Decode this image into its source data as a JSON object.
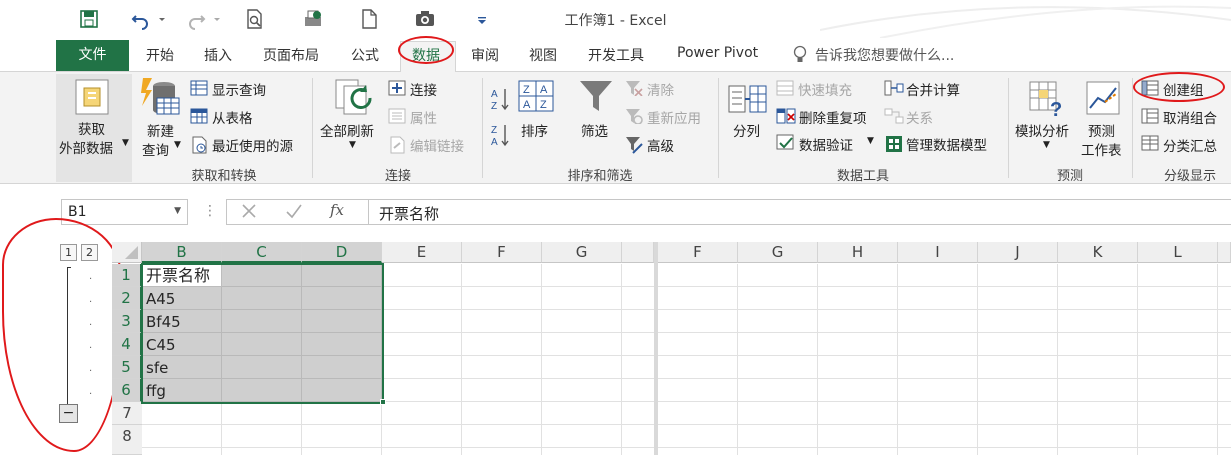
{
  "title": "工作簿1 - Excel",
  "tabs": [
    "开始",
    "插入",
    "页面布局",
    "公式",
    "数据",
    "审阅",
    "视图",
    "开发工具",
    "Power Pivot"
  ],
  "file_tab": "文件",
  "tell_me": "告诉我您想要做什么...",
  "ribbon": {
    "get_external": [
      "获取",
      "外部数据"
    ],
    "new_query": [
      "新建",
      "查询"
    ],
    "show_queries": "显示查询",
    "from_table": "从表格",
    "recent_sources": "最近使用的源",
    "group_get_transform": "获取和转换",
    "refresh_all": "全部刷新",
    "connections": "连接",
    "properties": "属性",
    "edit_links": "编辑链接",
    "group_connections": "连接",
    "sort": "排序",
    "filter": "筛选",
    "clear": "清除",
    "reapply": "重新应用",
    "advanced": "高级",
    "group_sort_filter": "排序和筛选",
    "text_to_columns": "分列",
    "flash_fill": "快速填充",
    "remove_duplicates": "删除重复项",
    "data_validation": "数据验证",
    "consolidate": "合并计算",
    "relationships": "关系",
    "manage_data_model": "管理数据模型",
    "group_data_tools": "数据工具",
    "what_if": "模拟分析",
    "forecast_sheet": [
      "预测",
      "工作表"
    ],
    "group_forecast": "预测",
    "group": "创建组",
    "ungroup": "取消组合",
    "subtotal": "分类汇总",
    "group_outline": "分级显示"
  },
  "formula_bar": {
    "name_box": "B1",
    "formula": "开票名称",
    "fx": "fx"
  },
  "outline_levels": [
    "1",
    "2"
  ],
  "outline_collapse": "−",
  "left_columns": [
    "B",
    "C",
    "D",
    "E",
    "F",
    "G"
  ],
  "right_columns": [
    "F",
    "G",
    "H",
    "I",
    "J",
    "K",
    "L"
  ],
  "rows": [
    "1",
    "2",
    "3",
    "4",
    "5",
    "6",
    "7",
    "8"
  ],
  "cells_b": [
    "开票名称",
    "A45",
    "Bf45",
    "C45",
    "sfe",
    "ffg"
  ],
  "colors": {
    "excel_green": "#217346",
    "annotation_red": "#e0191b"
  }
}
